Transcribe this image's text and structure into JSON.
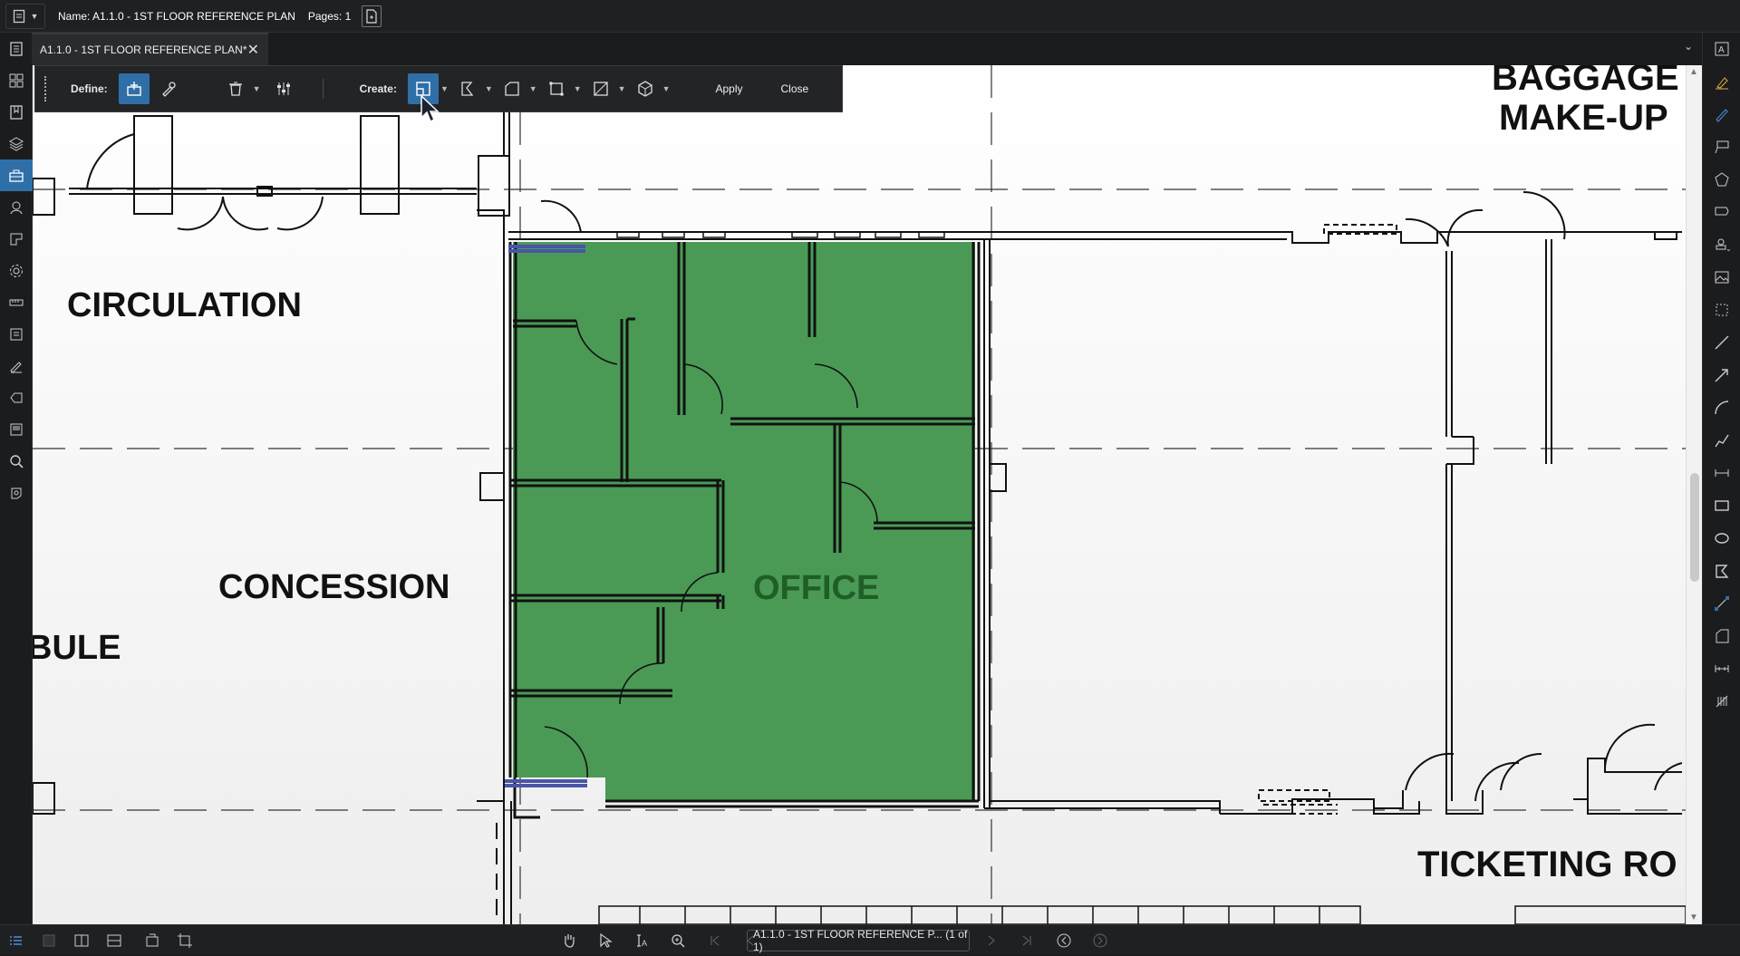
{
  "topbar": {
    "name_label": "Name: A1.1.0 - 1ST FLOOR  REFERENCE PLAN",
    "pages_label": "Pages: 1",
    "file_icon": "document-icon",
    "newdoc_icon": "new-document-icon"
  },
  "tab": {
    "title": "A1.1.0 - 1ST FLOOR  REFERENCE PLAN*",
    "close": "✕",
    "dropdown": "⌄"
  },
  "toolbar": {
    "define_label": "Define:",
    "create_label": "Create:",
    "apply_label": "Apply",
    "close_label": "Close"
  },
  "plan": {
    "room_circulation": "CIRCULATION",
    "room_concession": "CONCESSION",
    "room_vestibule": "BULE",
    "room_office": "OFFICE",
    "room_baggage_line1": "BAGGAGE",
    "room_baggage_line2": "MAKE-UP",
    "room_ticketing": "TICKETING RO",
    "office_fill": "#4a9a55",
    "office_label_color": "#1f5e27",
    "selection_color": "#4a55a8"
  },
  "status": {
    "page_selector": "A1.1.0 - 1ST FLOOR  REFERENCE P... (1 of 1)"
  },
  "colors": {
    "accent": "#2f6fa7",
    "chrome": "#1b1c1e"
  }
}
